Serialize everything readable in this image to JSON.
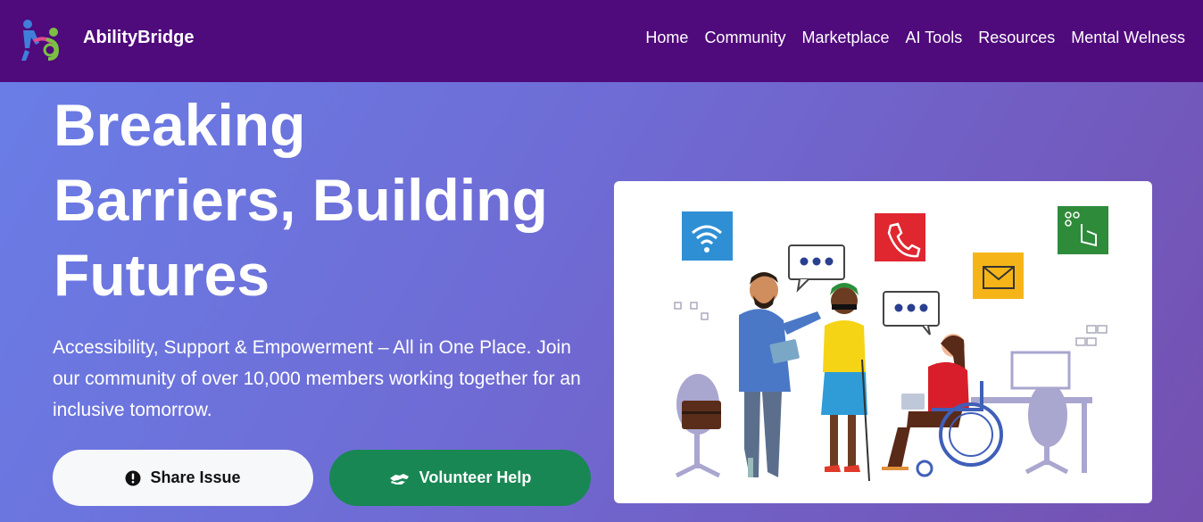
{
  "brand": {
    "name": "AbilityBridge",
    "logo_icon": "person-helping-logo-icon"
  },
  "nav": {
    "items": [
      {
        "label": "Home"
      },
      {
        "label": "Community"
      },
      {
        "label": "Marketplace"
      },
      {
        "label": "AI Tools"
      },
      {
        "label": "Resources"
      },
      {
        "label": "Mental Welness"
      }
    ]
  },
  "hero": {
    "title_lines": [
      "Breaking",
      "Barriers, Building",
      "Futures"
    ],
    "subtitle": "Accessibility, Support & Empowerment – All in One Place. Join our community of over 10,000 members working together for an inclusive tomorrow.",
    "buttons": {
      "share": {
        "label": "Share Issue",
        "icon": "exclamation-circle-icon"
      },
      "volunteer": {
        "label": "Volunteer Help",
        "icon": "helping-hands-icon"
      }
    }
  },
  "colors": {
    "navbar_bg": "#4f0a7c",
    "hero_gradient_start": "#6a7de6",
    "hero_gradient_end": "#7450b0",
    "volunteer_button": "#198754",
    "share_button": "#f7f8fa"
  }
}
